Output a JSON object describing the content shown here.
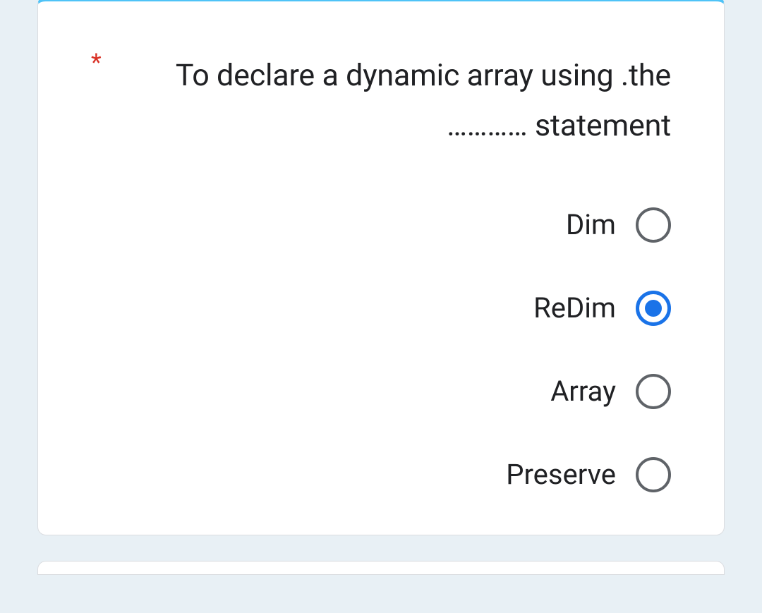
{
  "question": {
    "required_marker": "*",
    "text": "To declare a dynamic array using .the ………… statement"
  },
  "options": [
    {
      "label": "Dim",
      "selected": false
    },
    {
      "label": "ReDim",
      "selected": true
    },
    {
      "label": "Array",
      "selected": false
    },
    {
      "label": "Preserve",
      "selected": false
    }
  ]
}
